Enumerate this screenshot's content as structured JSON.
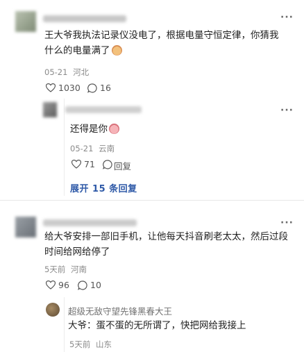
{
  "comments": [
    {
      "text": "王大爷我执法记录仪没电了，根据电量守恒定律，你猜我什么的电量满了",
      "date": "05-21",
      "location": "河北",
      "likes": "1030",
      "replies_count": "16",
      "reply": {
        "text": "还得是你",
        "date": "05-21",
        "location": "云南",
        "likes": "71",
        "reply_label": "回复"
      },
      "expand_label": "展开 15 条回复"
    },
    {
      "text": "给大爷安排一部旧手机，让他每天抖音刷老太太，然后过段时间给网给停了",
      "time": "5天前",
      "location": "河南",
      "likes": "96",
      "replies_count": "10",
      "reply": {
        "author": "超级无敌守望先锋黑春大王",
        "text": "大爷：蛋不蛋的无所谓了，快把网给我接上",
        "time": "5天前",
        "location": "山东"
      }
    }
  ],
  "icons": {
    "more": "more-dots-icon",
    "like": "heart-icon",
    "comment": "comment-bubble-icon"
  },
  "colors": {
    "link": "#2f5aa8",
    "meta": "#8a8a8a"
  }
}
